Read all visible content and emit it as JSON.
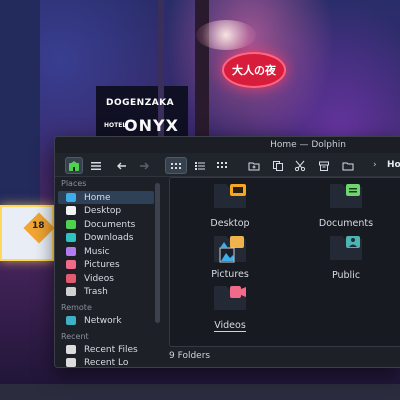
{
  "wallpaper": {
    "sign_dogenzaka": "DOGENZAKA",
    "sign_hotel": "HOTEL",
    "sign_onyx": "ONYX",
    "sign_red_circle": "大人の夜",
    "sign_yellow_number": "18"
  },
  "window": {
    "title": "Home — Dolphin",
    "breadcrumb": "Ho"
  },
  "sidebar": {
    "places_heading": "Places",
    "remote_heading": "Remote",
    "recent_heading": "Recent",
    "items": [
      {
        "label": "Home",
        "icon": "home-icon",
        "color": "#3daee9"
      },
      {
        "label": "Desktop",
        "icon": "desktop-icon",
        "color": "#f3f3f3"
      },
      {
        "label": "Documents",
        "icon": "documents-icon",
        "color": "#4fd24f"
      },
      {
        "label": "Downloads",
        "icon": "downloads-icon",
        "color": "#2ec2c2"
      },
      {
        "label": "Music",
        "icon": "music-icon",
        "color": "#b27cf0"
      },
      {
        "label": "Pictures",
        "icon": "pictures-icon",
        "color": "#f06a8a"
      },
      {
        "label": "Videos",
        "icon": "videos-icon",
        "color": "#e25b6e"
      },
      {
        "label": "Trash",
        "icon": "trash-icon",
        "color": "#d0d0d0"
      }
    ],
    "remote_items": [
      {
        "label": "Network",
        "icon": "network-icon",
        "color": "#3fb1c4"
      }
    ],
    "recent_items": [
      {
        "label": "Recent Files",
        "icon": "recent-files-icon",
        "color": "#dcdcdc"
      },
      {
        "label": "Recent Lo",
        "icon": "recent-locations-icon",
        "color": "#dcdcdc"
      }
    ]
  },
  "folders": [
    {
      "label": "Desktop",
      "color": "#f5a623"
    },
    {
      "label": "Documents",
      "color": "#6fd66f"
    },
    {
      "label": "Pictures",
      "color": "#f0b24a"
    },
    {
      "label": "Public",
      "color": "#4fb3b3"
    },
    {
      "label": "Videos",
      "color": "#f06a8a"
    }
  ],
  "status": {
    "count": "9 Folders"
  },
  "colors": {
    "accent": "#3daee9",
    "window_bg": "#1d2027",
    "view_bg": "#171a20"
  }
}
